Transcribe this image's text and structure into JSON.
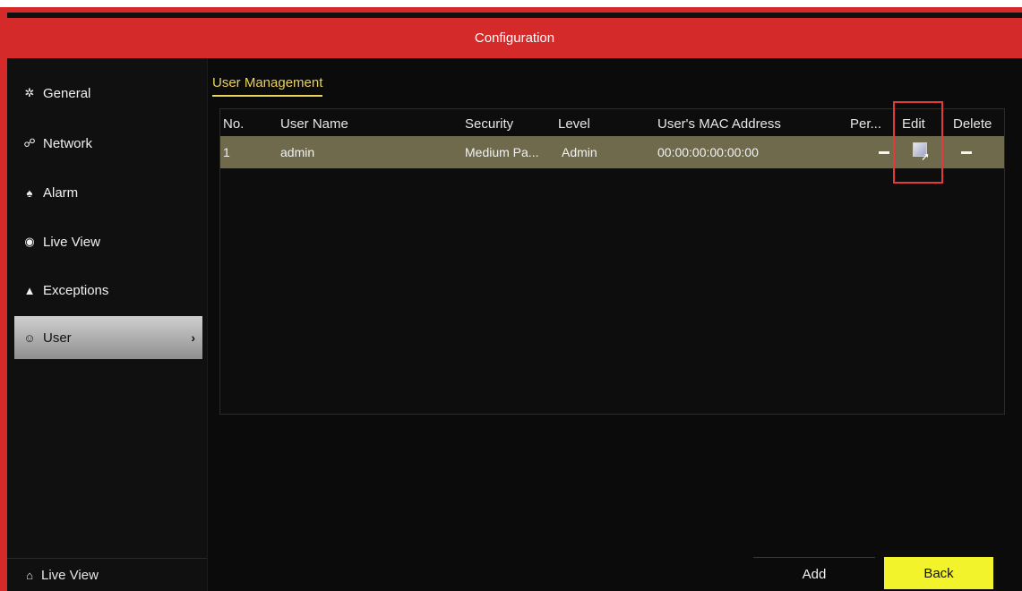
{
  "window": {
    "title": "Configuration"
  },
  "sidebar": {
    "items": [
      {
        "label": "General",
        "icon": "gear-icon",
        "glyph": "✲"
      },
      {
        "label": "Network",
        "icon": "network-icon",
        "glyph": "☍"
      },
      {
        "label": "Alarm",
        "icon": "alarm-icon",
        "glyph": "♠"
      },
      {
        "label": "Live View",
        "icon": "eye-icon",
        "glyph": "◉"
      },
      {
        "label": "Exceptions",
        "icon": "warning-icon",
        "glyph": "▲"
      },
      {
        "label": "User",
        "icon": "users-icon",
        "glyph": "☺",
        "active": true
      }
    ],
    "bottom": {
      "label": "Live View",
      "icon": "home-icon",
      "glyph": "⌂"
    }
  },
  "main": {
    "tab": "User Management",
    "table": {
      "headers": [
        "No.",
        "User Name",
        "Security",
        "Level",
        "User's MAC Address",
        "Per...",
        "Edit",
        "Delete"
      ],
      "rows": [
        {
          "no": "1",
          "user_name": "admin",
          "security": "Medium Pa...",
          "level": "Admin",
          "mac": "00:00:00:00:00:00"
        }
      ]
    }
  },
  "footer": {
    "add_label": "Add",
    "back_label": "Back"
  },
  "colors": {
    "titlebar": "#d42a2a",
    "selected_row": "#6f6a4c",
    "back_button": "#f3f32c",
    "tab_accent": "#e8d25a",
    "highlight": "#e23a3a"
  }
}
